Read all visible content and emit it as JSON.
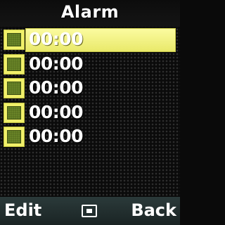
{
  "header": {
    "title": "Alarm"
  },
  "alarms": [
    {
      "time": "00:00",
      "selected": true
    },
    {
      "time": "00:00",
      "selected": false
    },
    {
      "time": "00:00",
      "selected": false
    },
    {
      "time": "00:00",
      "selected": false
    },
    {
      "time": "00:00",
      "selected": false
    }
  ],
  "softkeys": {
    "left": "Edit",
    "center_icon": "select-square-icon",
    "right": "Back"
  },
  "colors": {
    "highlight": "#fbfba0",
    "checkbox": "#f0f06a",
    "checkbox_fill": "#58701f",
    "softkey_bar": "#2b3a3a"
  }
}
